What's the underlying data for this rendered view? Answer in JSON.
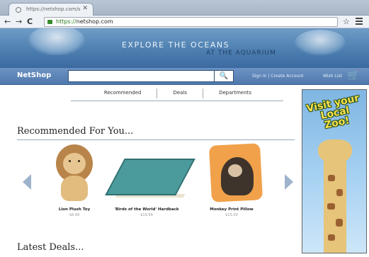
{
  "browser": {
    "tab_title": "https://netshop.com/s",
    "tab_close": "✕",
    "url_scheme": "https://",
    "url_host": "netshop.com",
    "star_icon": "star-icon",
    "menu_icon": "hamburger-icon"
  },
  "hero": {
    "line1": "EXPLORE THE OCEANS",
    "line2": "AT THE AQUARIUM"
  },
  "header": {
    "logo": "NetShop",
    "search_placeholder": "",
    "search_icon": "🔍",
    "account_link": "Sign In | Create Account",
    "wishlist_link": "Wish List",
    "cart_icon": "🛒"
  },
  "subnav": {
    "items": [
      "Recommended",
      "Deals",
      "Departments"
    ]
  },
  "main": {
    "recommended_title": "Recommended For You...",
    "products": [
      {
        "name": "Lion Plush Toy",
        "price": "$8.99"
      },
      {
        "name": "'Birds of the World' Hardback",
        "price": "$19.99"
      },
      {
        "name": "Monkey Print Pillow",
        "price": "$15.00"
      }
    ],
    "latest_title": "Latest Deals..."
  },
  "ad": {
    "text": "Visit your Local Zoo!"
  },
  "colors": {
    "accent": "#4f78ad",
    "hero": "#4e7fb0"
  }
}
